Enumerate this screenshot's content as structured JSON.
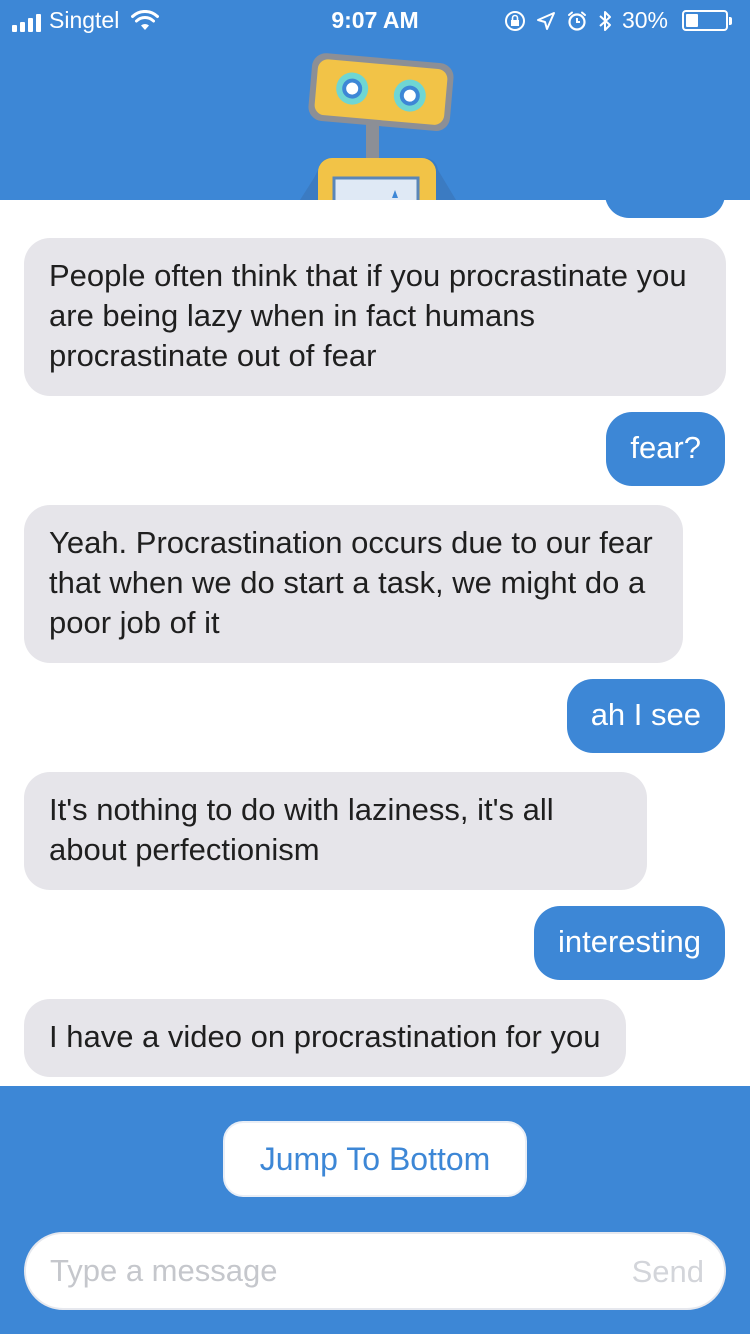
{
  "status_bar": {
    "carrier": "Singtel",
    "time": "9:07 AM",
    "battery_percent": "30%",
    "battery_level": 0.3,
    "icons": [
      "signal-bars-icon",
      "wifi-icon",
      "orientation-lock-icon",
      "location-arrow-icon",
      "alarm-clock-icon",
      "bluetooth-icon",
      "battery-icon"
    ]
  },
  "header": {
    "mascot": "robot-mascot-icon",
    "background_color": "#3d87d6",
    "mascot_colors": {
      "head": "#f2c347",
      "eyes": "#6fd6d3",
      "frame": "#8c8f96"
    }
  },
  "messages": [
    {
      "sender": "bot",
      "text": "People often think that if you procrastinate you are being lazy when in fact humans procrastinate out of fear"
    },
    {
      "sender": "user",
      "text": "fear?"
    },
    {
      "sender": "bot",
      "text": "Yeah. Procrastination occurs due to our fear that when we do start a task, we might do a poor job of it"
    },
    {
      "sender": "user",
      "text": "ah I see"
    },
    {
      "sender": "bot",
      "text": "It's nothing to do with laziness, it's all about perfectionism"
    },
    {
      "sender": "user",
      "text": "interesting"
    },
    {
      "sender": "bot",
      "text": "I have a video on procrastination for you"
    }
  ],
  "footer": {
    "jump_label": "Jump To Bottom",
    "input_placeholder": "Type a message",
    "input_value": "",
    "send_label": "Send"
  },
  "colors": {
    "accent": "#3d87d6",
    "bot_bubble": "#e6e5ea",
    "user_bubble": "#3d87d6"
  }
}
